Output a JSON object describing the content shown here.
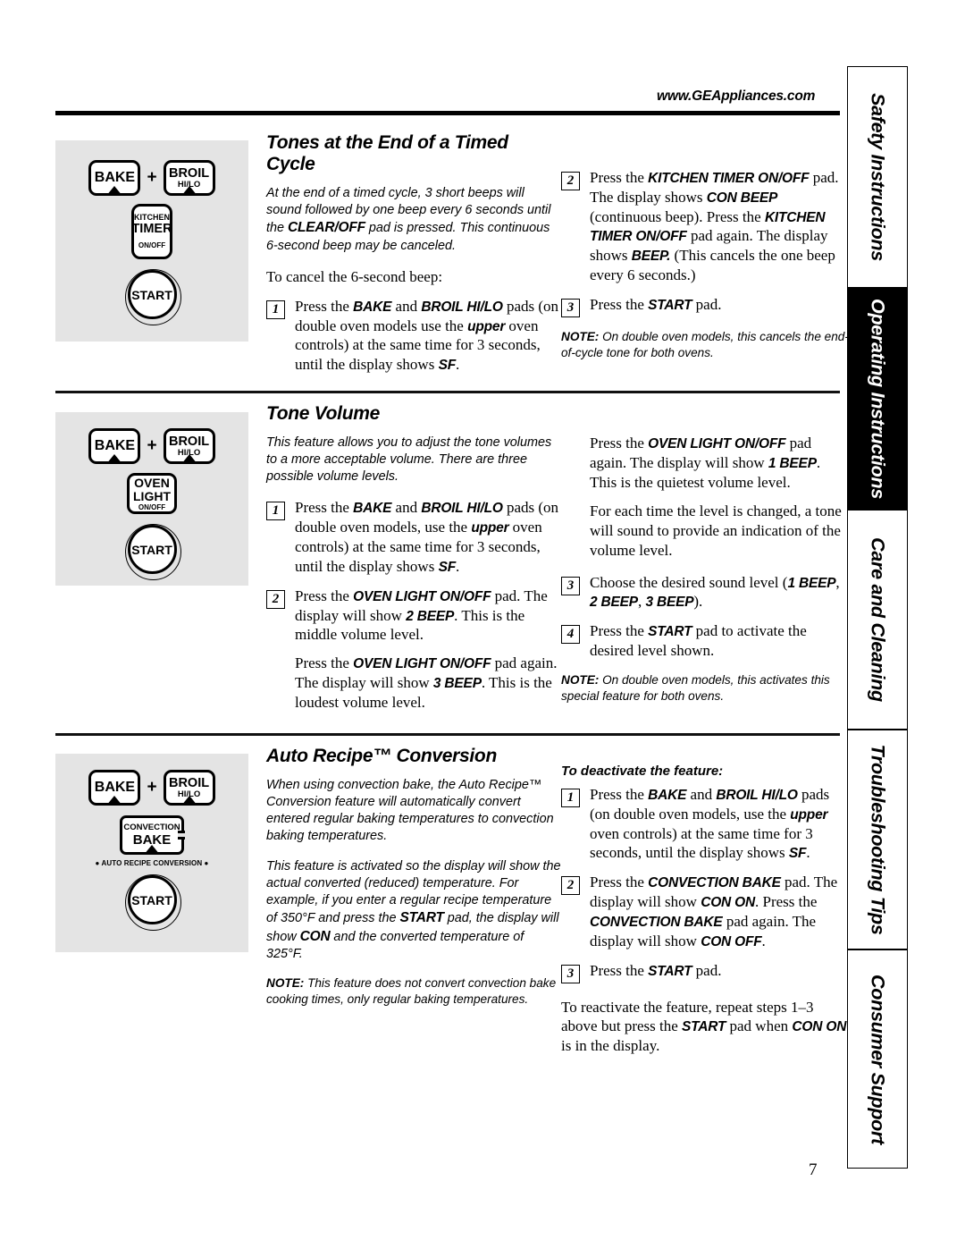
{
  "header": {
    "url": "www.GEAppliances.com"
  },
  "page_number": "7",
  "sidebar": {
    "tabs": [
      {
        "label": "Safety Instructions",
        "active": false
      },
      {
        "label": "Operating Instructions",
        "active": true
      },
      {
        "label": "Care and Cleaning",
        "active": false
      },
      {
        "label": "Troubleshooting Tips",
        "active": false
      },
      {
        "label": "Consumer Support",
        "active": false
      }
    ]
  },
  "sections": [
    {
      "id": "tones-at-end-of-timed-cycle",
      "title": "Tones at the End of a Timed Cycle",
      "pads": {
        "bake": "BAKE",
        "plus": "+",
        "broil_line1": "BROIL",
        "broil_line2": "HI/LO",
        "timer_line1": "KITCHEN",
        "timer_line2": "TIMER",
        "timer_line3": "ON/OFF",
        "start": "START"
      },
      "intro": "At the end of a timed cycle, 3 short beeps will sound followed by one beep every 6 seconds until the CLEAR/OFF pad is pressed. This continuous 6-second beep may be canceled.",
      "intro_parts": {
        "a": "At the end of a timed cycle, 3 short beeps will sound followed by one beep every 6 seconds until the ",
        "b": "CLEAR/OFF",
        "c": " pad is pressed. This continuous 6-second beep may be canceled."
      },
      "lead": "To cancel the 6-second beep:",
      "steps": [
        {
          "num": "1",
          "parts": {
            "p1": "Press the ",
            "b1": "BAKE",
            "p2": " and ",
            "b2": "BROIL HI/LO",
            "p3": " pads (on double oven models use the ",
            "b3": "upper",
            "p4": " oven controls) at the same time for 3 seconds, until the display shows ",
            "b4": "SF",
            "p5": "."
          }
        },
        {
          "num": "2",
          "parts": {
            "p1": "Press the ",
            "b1": "KITCHEN TIMER ON/OFF",
            "p2": " pad. The display shows ",
            "b2": "CON BEEP",
            "p3": " (continuous beep). Press the ",
            "b3": "KITCHEN TIMER ON/OFF",
            "p4": " pad again. The display shows ",
            "b4": "BEEP.",
            "p5": " (This cancels the one beep every 6 seconds.)"
          }
        },
        {
          "num": "3",
          "parts": {
            "p1": "Press the ",
            "b1": "START",
            "p2": " pad."
          }
        }
      ],
      "note_label": "NOTE:",
      "note_text": " On double oven models, this cancels the end-of-cycle tone for both ovens."
    },
    {
      "id": "tone-volume",
      "title": "Tone Volume",
      "pads": {
        "bake": "BAKE",
        "plus": "+",
        "broil_line1": "BROIL",
        "broil_line2": "HI/LO",
        "light_line1": "OVEN",
        "light_line2": "LIGHT",
        "light_line3": "ON/OFF",
        "start": "START"
      },
      "intro": "This feature allows you to adjust the tone volumes to a more acceptable volume. There are three possible volume levels.",
      "steps": [
        {
          "num": "1",
          "parts": {
            "p1": "Press the ",
            "b1": "BAKE",
            "p2": " and ",
            "b2": "BROIL HI/LO",
            "p3": " pads (on double oven models, use the ",
            "b3": "upper",
            "p4": " oven controls) at the same time for 3 seconds, until the display shows ",
            "b4": "SF",
            "p5": "."
          }
        },
        {
          "num": "2",
          "parts": {
            "p1": "Press the ",
            "b1": "OVEN LIGHT ON/OFF",
            "p2": " pad. The display will show ",
            "b2": "2 BEEP",
            "p3": ". This is the middle volume level.",
            "cont_p1": "Press the ",
            "cont_b1": "OVEN LIGHT ON/OFF",
            "cont_p2": " pad again. The display will show ",
            "cont_b2": "3 BEEP",
            "cont_p3": ". This is the loudest volume level."
          }
        },
        {
          "num": "3",
          "parts": {
            "p1": "Choose the desired sound level (",
            "b1": "1 BEEP",
            "p2": ", ",
            "b2": "2 BEEP",
            "p3": ", ",
            "b3": "3 BEEP",
            "p4": ")."
          }
        },
        {
          "num": "4",
          "parts": {
            "p1": "Press the ",
            "b1": "START",
            "p2": " pad to activate the desired level shown."
          }
        }
      ],
      "right_para1": {
        "p1": "Press the ",
        "b1": "OVEN LIGHT ON/OFF",
        "p2": " pad again. The display will show ",
        "b2": "1 BEEP",
        "p3": ". This is the quietest volume level."
      },
      "right_para2": "For each time the level is changed, a tone will sound to provide an indication of the volume level.",
      "note_label": "NOTE:",
      "note_text": " On double oven models, this activates this special feature for both ovens."
    },
    {
      "id": "auto-recipe-conversion",
      "title": "Auto Recipe™ Conversion",
      "pads": {
        "bake": "BAKE",
        "plus": "+",
        "broil_line1": "BROIL",
        "broil_line2": "HI/LO",
        "conv_line1": "CONVECTION",
        "conv_line2": "BAKE",
        "conv_caption": "● AUTO RECIPE CONVERSION ●",
        "start": "START"
      },
      "intro1": "When using convection bake, the Auto Recipe™ Conversion feature will automatically convert entered regular baking temperatures to convection baking temperatures.",
      "intro2": {
        "p1": "This feature is activated so the display will show the actual converted (reduced) temperature. For example, if you enter a regular recipe temperature of 350°F and press the ",
        "b1": "START",
        "p2": " pad, the display will show ",
        "b2": "CON",
        "p3": " and the converted temperature of 325°F."
      },
      "note_label": "NOTE:",
      "note_text": " This feature does not convert convection bake cooking times, only regular baking temperatures.",
      "deactivate_head": "To deactivate the feature:",
      "steps": [
        {
          "num": "1",
          "parts": {
            "p1": "Press the ",
            "b1": "BAKE",
            "p2": " and ",
            "b2": "BROIL HI/LO",
            "p3": " pads (on double oven models, use the ",
            "b3": "upper",
            "p4": " oven controls) at the same time for 3 seconds, until the display shows ",
            "b4": "SF",
            "p5": "."
          }
        },
        {
          "num": "2",
          "parts": {
            "p1": "Press the ",
            "b1": "CONVECTION BAKE",
            "p2": " pad. The display will show ",
            "b2": "CON ON",
            "p3": ". Press the ",
            "b3": "CONVECTION BAKE",
            "p4": " pad again. The display will show ",
            "b4": "CON OFF",
            "p5": "."
          }
        },
        {
          "num": "3",
          "parts": {
            "p1": "Press the ",
            "b1": "START",
            "p2": " pad."
          }
        }
      ],
      "reactivate": {
        "p1": "To reactivate the feature, repeat steps 1–3 above but press the ",
        "b1": "START",
        "p2": " pad when ",
        "b2": "CON ON",
        "p3": " is in the display."
      }
    }
  ]
}
